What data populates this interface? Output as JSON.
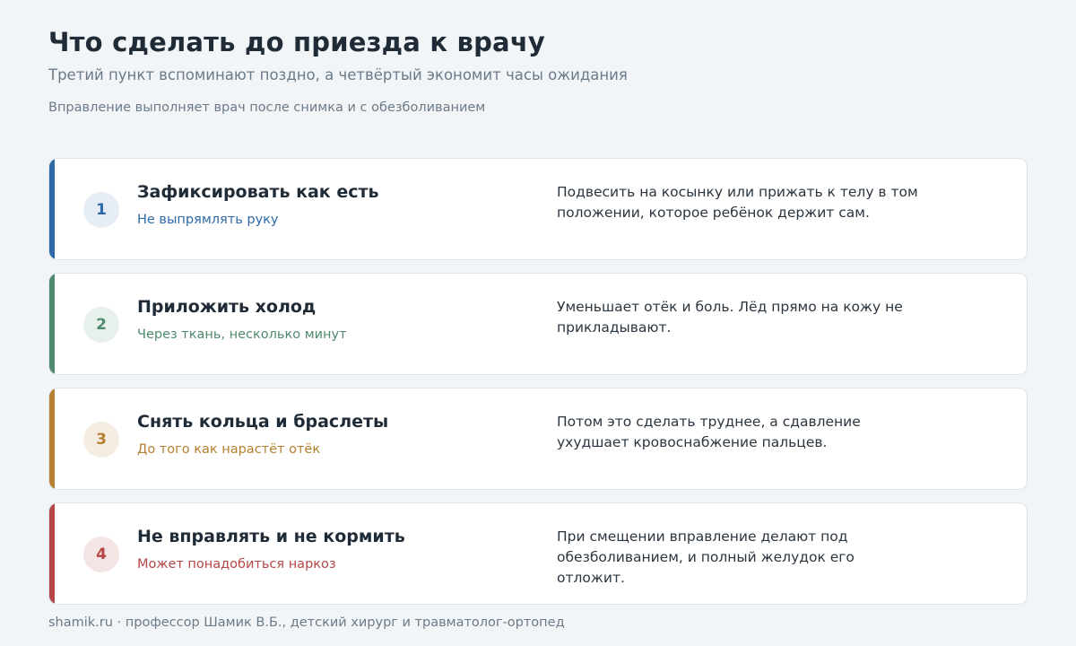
{
  "header": {
    "title": "Что сделать до приезда к врачу",
    "subtitle": "Третий пункт вспоминают поздно, а четвёртый экономит часы ожидания",
    "note": "Вправление выполняет врач после снимка и с обезболиванием"
  },
  "cards": [
    {
      "number": "1",
      "title": "Зафиксировать как есть",
      "subtitle": "Не выпрямлять руку",
      "description": "Подвесить на косынку или прижать к телу в том положении, которое ребёнок держит сам.",
      "accent": "#2f6aa8",
      "badge_bg": "#e6edf4"
    },
    {
      "number": "2",
      "title": "Приложить холод",
      "subtitle": "Через ткань, несколько минут",
      "description": "Уменьшает отёк и боль. Лёд прямо на кожу не прикладывают.",
      "accent": "#4f8a6e",
      "badge_bg": "#e8f0ec"
    },
    {
      "number": "3",
      "title": "Снять кольца и браслеты",
      "subtitle": "До того как нарастёт отёк",
      "description": "Потом это сделать труднее, а сдавление ухудшает кровоснабжение пальцев.",
      "accent": "#b5802f",
      "badge_bg": "#f5ede2"
    },
    {
      "number": "4",
      "title": "Не вправлять и не кормить",
      "subtitle": "Может понадобиться наркоз",
      "description": "При смещении вправление делают под обезболиванием, и полный желудок его отложит.",
      "accent": "#b44646",
      "badge_bg": "#f5e4e4"
    }
  ],
  "footer": {
    "text": "shamik.ru · профессор Шамик В.Б., детский хирург и травматолог-ортопед"
  }
}
